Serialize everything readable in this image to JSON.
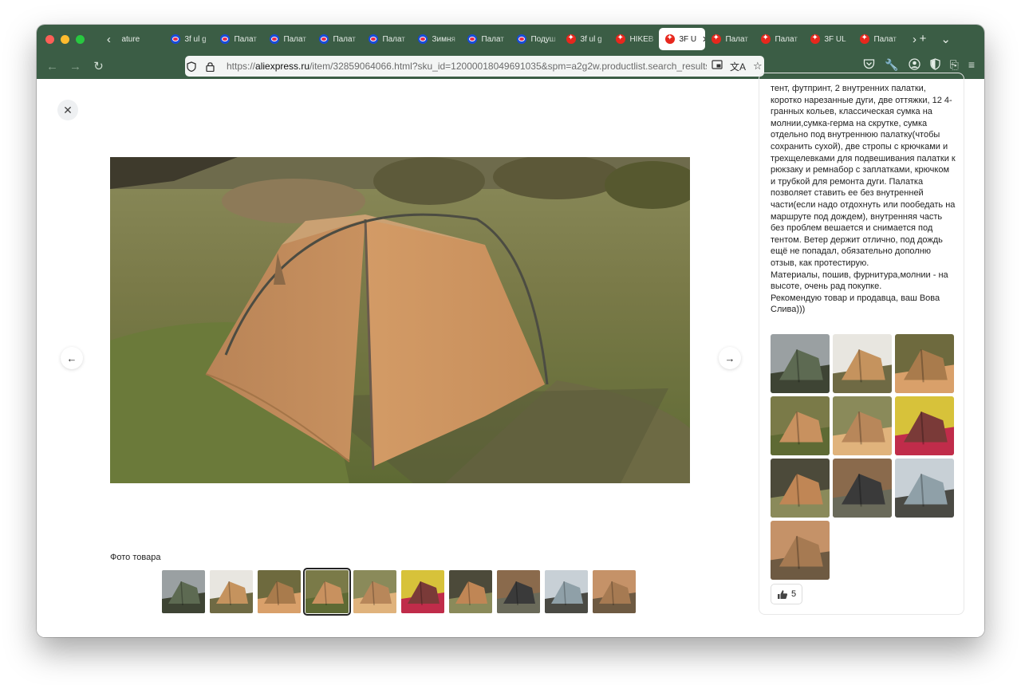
{
  "tabs": [
    {
      "label": "ature",
      "favicon": "prev-site-icon"
    },
    {
      "label": "3f ul g",
      "favicon": "ozon-icon"
    },
    {
      "label": "Палат",
      "favicon": "ozon-icon"
    },
    {
      "label": "Палат",
      "favicon": "ozon-icon"
    },
    {
      "label": "Палат",
      "favicon": "ozon-icon"
    },
    {
      "label": "Палат",
      "favicon": "ozon-icon"
    },
    {
      "label": "Зимня",
      "favicon": "ozon-icon"
    },
    {
      "label": "Палат",
      "favicon": "ozon-icon"
    },
    {
      "label": "Подуш",
      "favicon": "ozon-icon"
    },
    {
      "label": "3f ul g",
      "favicon": "aliexpress-icon"
    },
    {
      "label": "HIKEB",
      "favicon": "aliexpress-icon"
    },
    {
      "label": "3F U",
      "favicon": "aliexpress-icon",
      "active": true
    },
    {
      "label": "Палат",
      "favicon": "aliexpress-icon"
    },
    {
      "label": "Палат",
      "favicon": "aliexpress-icon"
    },
    {
      "label": "3F UL",
      "favicon": "aliexpress-icon"
    },
    {
      "label": "Палат",
      "favicon": "aliexpress-icon"
    }
  ],
  "address": {
    "prefix": "https://",
    "host": "aliexpress.ru",
    "path": "/item/32859064066.html?sku_id=12000018049691035&spm=a2g2w.productlist.search_results"
  },
  "gallery": {
    "label": "Фото товара",
    "thumb_count": 10,
    "selected_index": 3
  },
  "review": {
    "paragraphs": [
      "тент, футпринт, 2 внутренних палатки, коротко нарезанные дуги, две оттяжки, 12 4-гранных кольев, классическая сумка на молнии,сумка-герма на скрутке, сумка отдельно под внутреннюю палатку(чтобы сохранить сухой), две стропы с крючками и трехщелевками для подвешивания палатки к рюкзаку и ремнабор с заплатками, крючком и трубкой для ремонта дуги. Палатка позволяет ставить ее без внутренней части(если надо отдохнуть или пообедать на маршруте под дождем), внутренняя часть без проблем вешается и снимается под тентом. Ветер держит отлично, под дождь ещё не попадал, обязательно дополню отзыв, как протестирую.",
      "Материалы, пошив, фурнитура,молнии - на высоте, очень рад покупке.",
      "Рекомендую товар и продавца, ваш Вова Слива)))"
    ],
    "photo_count": 10,
    "likes": "5"
  },
  "colors": {
    "chrome": "#3b5d45",
    "tent": "#c8915f"
  }
}
